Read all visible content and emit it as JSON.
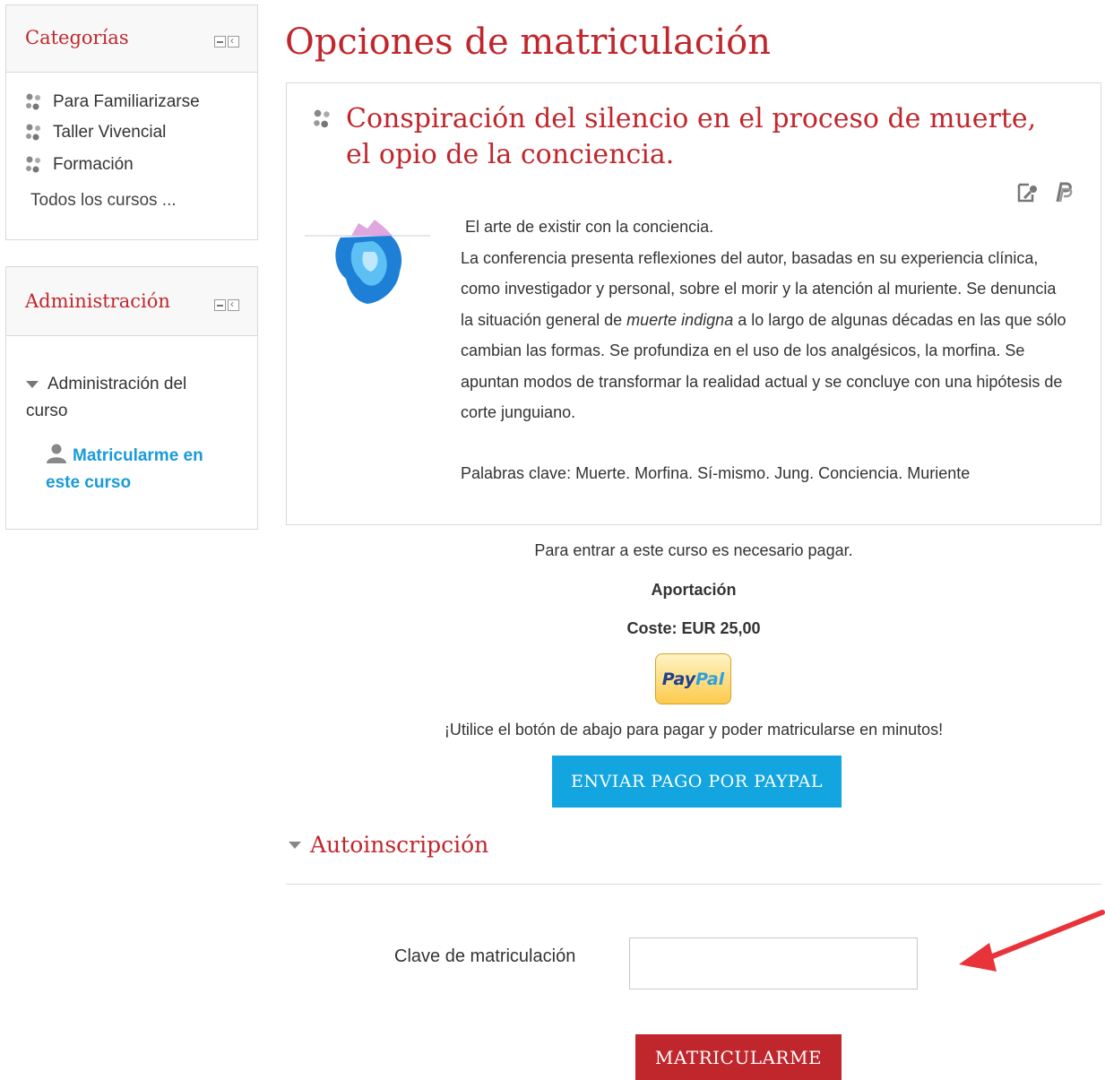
{
  "sidebar": {
    "categories": {
      "title": "Categorías",
      "items": [
        {
          "label": "Para Familiarizarse"
        },
        {
          "label": "Taller Vivencial"
        },
        {
          "label": "Formación"
        }
      ],
      "all_courses": "Todos los cursos ..."
    },
    "administration": {
      "title": "Administración",
      "course_admin": "Administración del curso",
      "enrol_link": "Matricularme en este curso"
    }
  },
  "main": {
    "page_title": "Opciones de matriculación",
    "course": {
      "title": "Conspiración del silencio en el proceso de muerte, el opio de la conciencia.",
      "summary_intro": "El arte de existir con la conciencia.",
      "summary_part1": "La conferencia presenta reflexiones del autor, basadas en su experiencia clínica, como investigador y personal, sobre el morir y la atención al muriente. Se denuncia la situación general de ",
      "summary_emphasis": "muerte indigna",
      "summary_part2": " a lo largo de algunas décadas en las que sólo cambian las formas. Se profundiza en el uso de los analgésicos, la morfina. Se apuntan modos de transformar la realidad actual y se concluye con una hipótesis de corte junguiano.",
      "keywords": "Palabras clave: Muerte. Morfina. Sí-mismo. Jung. Conciencia. Muriente"
    },
    "payment": {
      "notice": "Para entrar a este curso es necesario pagar.",
      "contribution": "Aportación",
      "cost": "Coste: EUR 25,00",
      "paypal_logo_a": "Pay",
      "paypal_logo_b": "Pal",
      "instruction": "¡Utilice el botón de abajo para pagar y poder matricularse en minutos!",
      "send_button": "ENVIAR PAGO POR PAYPAL"
    },
    "self_enrol": {
      "section_title": "Autoinscripción",
      "key_label": "Clave de matriculación",
      "key_value": "",
      "enrol_button": "MATRICULARME"
    }
  },
  "colors": {
    "accent_red": "#c0272d",
    "link_blue": "#1a9bd7",
    "button_blue": "#12a5e0",
    "arrow_red": "#e8333a"
  }
}
